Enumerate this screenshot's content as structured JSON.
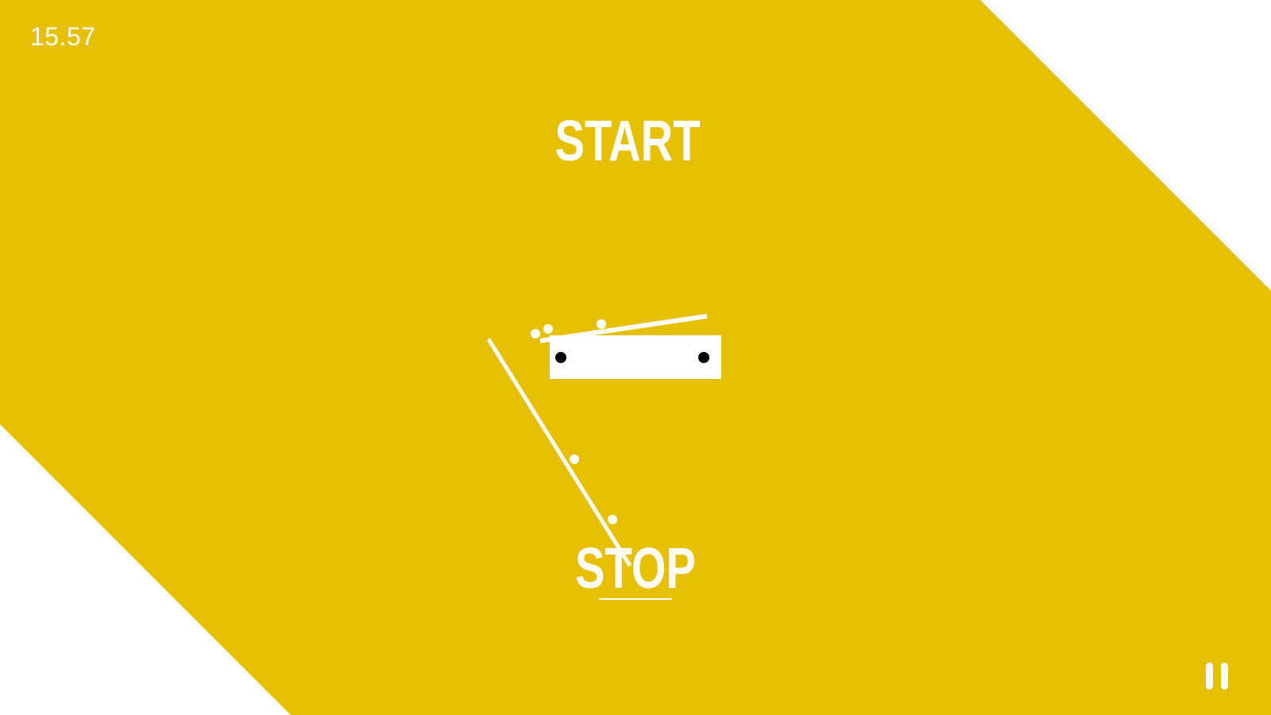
{
  "game": {
    "timer": "15.57",
    "start_label": "START",
    "stop_label": "STOP"
  },
  "colors": {
    "background": "#ffffff",
    "band": "#e5bf00",
    "foreground": "#ffffff",
    "marker": "#000000"
  },
  "icons": {
    "pause": "pause-icon"
  }
}
